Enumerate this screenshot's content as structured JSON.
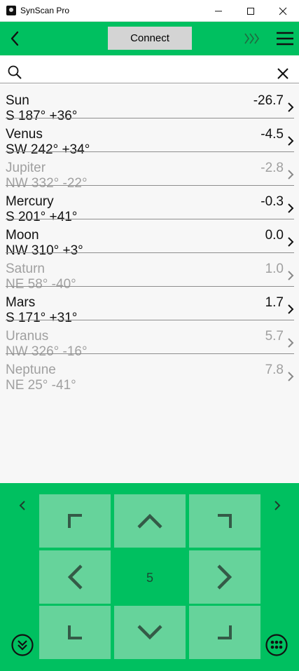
{
  "window": {
    "title": "SynScan Pro",
    "minimize": "—",
    "maximize": "☐",
    "close": "✕"
  },
  "header": {
    "connect_label": "Connect"
  },
  "search": {
    "value": "",
    "placeholder": ""
  },
  "objects": [
    {
      "name": "Sun",
      "position": "S 187°  +36°",
      "magnitude": "-26.7",
      "visible": true
    },
    {
      "name": "Venus",
      "position": "SW 242°  +34°",
      "magnitude": "-4.5",
      "visible": true
    },
    {
      "name": "Jupiter",
      "position": "NW 332°  -22°",
      "magnitude": "-2.8",
      "visible": false
    },
    {
      "name": "Mercury",
      "position": "S 201°  +41°",
      "magnitude": "-0.3",
      "visible": true
    },
    {
      "name": "Moon",
      "position": "NW 310°  +3°",
      "magnitude": "0.0",
      "visible": true
    },
    {
      "name": "Saturn",
      "position": "NE 58°  -40°",
      "magnitude": "1.0",
      "visible": false
    },
    {
      "name": "Mars",
      "position": "S 171°  +31°",
      "magnitude": "1.7",
      "visible": true
    },
    {
      "name": "Uranus",
      "position": "NW 326°  -16°",
      "magnitude": "5.7",
      "visible": false
    },
    {
      "name": "Neptune",
      "position": "NE 25°  -41°",
      "magnitude": "7.8",
      "visible": false
    }
  ],
  "control_pad": {
    "rate": "5"
  },
  "colors": {
    "accent": "#00c060",
    "pad_button": "#66d39b",
    "dim_text": "#a0a0a0"
  },
  "icons": [
    "back-arrow-icon",
    "signal-icon",
    "hamburger-menu-icon",
    "search-icon",
    "clear-icon",
    "chevron-right-icon",
    "collapse-icon",
    "keypad-icon"
  ]
}
